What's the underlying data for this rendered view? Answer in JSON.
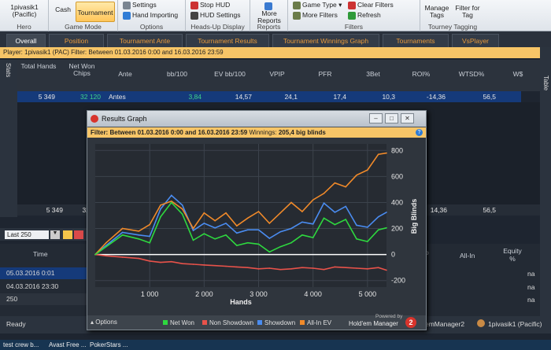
{
  "ribbon": {
    "hero": {
      "label": "1pivasik1 (Pacific)",
      "group": "Hero"
    },
    "game_mode": {
      "cash": "Cash",
      "tournament": "Tournament",
      "group": "Game Mode"
    },
    "options": {
      "settings": "Settings",
      "hand_importing": "Hand Importing",
      "group": "Options"
    },
    "hud": {
      "stop": "Stop HUD",
      "settings": "HUD Settings",
      "group": "Heads-Up Display"
    },
    "reports": {
      "more": "More Reports",
      "group": "Reports"
    },
    "filters": {
      "game_type": "Game Type",
      "more": "More Filters",
      "clear": "Clear Filters",
      "refresh": "Refresh",
      "group": "Filters"
    },
    "tagging": {
      "manage": "Manage Tags",
      "filter": "Filter for Tag",
      "group": "Tourney Tagging"
    }
  },
  "tabs": [
    "Overall",
    "Position",
    "Tournament Ante",
    "Tournament Results",
    "Tournament Winnings Graph",
    "Tournaments",
    "VsPlayer"
  ],
  "filter_line": "Player: 1pivasik1 (PAC)  Filter: Between 01.03.2016 0:00 and 16.03.2016 23:59",
  "side_left": "Stats",
  "side_right": "Table",
  "stats": {
    "columns": [
      "Total Hands",
      "Net Won Chips",
      "Ante",
      "bb/100",
      "EV bb/100",
      "VPIP",
      "PFR",
      "3Bet",
      "ROI%",
      "WTSD%",
      "W$"
    ],
    "row": [
      "5 349",
      "32 120",
      "Antes",
      "3,84",
      "14,57",
      "24,1",
      "17,4",
      "10,3",
      "-14,36",
      "56,5"
    ],
    "total": [
      "5 349",
      "32",
      "14,36",
      "56,5"
    ]
  },
  "session": {
    "range": "Last 250",
    "time_header": "Time",
    "rows": [
      "05.03.2016 0:01",
      "04.03.2016 23:30",
      "250"
    ]
  },
  "right_grid": {
    "headers": [
      "All-In",
      "Equity %"
    ],
    "values": [
      "na",
      "na",
      "na"
    ],
    "partial": "o"
  },
  "status": {
    "ready": "Ready",
    "manager": "emManager2",
    "player": "1pivasik1 (Pacific)"
  },
  "taskbar": [
    "test crew b...",
    "Avast Free ...",
    "PokerStars ..."
  ],
  "graph_window": {
    "title": "Results Graph",
    "filter_prefix": "Filter:",
    "filter_text": "Between 01.03.2016 0:00 and 16.03.2016 23:59",
    "winnings_label": "Winnings:",
    "winnings_value": "205,4 big blinds",
    "options": "Options",
    "powered_by": "Powered by",
    "brand": "Hold'em Manager"
  },
  "chart_data": {
    "type": "line",
    "title": "",
    "xlabel": "Hands",
    "ylabel": "Big Blinds",
    "xlim": [
      0,
      5349
    ],
    "ylim": [
      -250,
      850
    ],
    "x_ticks": [
      "1 000",
      "2 000",
      "3 000",
      "4 000",
      "5 000"
    ],
    "y_ticks": [
      "800",
      "600",
      "400",
      "200",
      "0",
      "-200"
    ],
    "series": [
      {
        "name": "Net Won",
        "color": "#2ed83f",
        "x": [
          0,
          200,
          500,
          800,
          1000,
          1200,
          1400,
          1600,
          1800,
          2000,
          2200,
          2400,
          2600,
          2800,
          3000,
          3200,
          3400,
          3600,
          3800,
          4000,
          4200,
          4400,
          4600,
          4800,
          5000,
          5200,
          5349
        ],
        "y": [
          0,
          60,
          150,
          120,
          90,
          290,
          400,
          310,
          110,
          160,
          120,
          150,
          70,
          90,
          80,
          20,
          60,
          90,
          150,
          130,
          280,
          230,
          270,
          120,
          100,
          190,
          205
        ]
      },
      {
        "name": "Non Showdown",
        "color": "#e8524a",
        "x": [
          0,
          200,
          500,
          800,
          1000,
          1200,
          1400,
          1600,
          1800,
          2000,
          2200,
          2400,
          2600,
          2800,
          3000,
          3200,
          3400,
          3600,
          3800,
          4000,
          4200,
          4400,
          4600,
          4800,
          5000,
          5200,
          5349
        ],
        "y": [
          0,
          -10,
          -20,
          -30,
          -50,
          -60,
          -55,
          -70,
          -75,
          -80,
          -85,
          -90,
          -95,
          -100,
          -110,
          -105,
          -115,
          -110,
          -100,
          -105,
          -115,
          -95,
          -100,
          -105,
          -110,
          -100,
          -120
        ]
      },
      {
        "name": "Showdown",
        "color": "#4a8cf0",
        "x": [
          0,
          200,
          500,
          800,
          1000,
          1200,
          1400,
          1600,
          1800,
          2000,
          2200,
          2400,
          2600,
          2800,
          3000,
          3200,
          3400,
          3600,
          3800,
          4000,
          4200,
          4400,
          4600,
          4800,
          5000,
          5200,
          5349
        ],
        "y": [
          0,
          70,
          170,
          150,
          140,
          350,
          455,
          380,
          185,
          240,
          205,
          240,
          165,
          190,
          190,
          125,
          175,
          200,
          250,
          235,
          395,
          325,
          370,
          225,
          210,
          290,
          325
        ]
      },
      {
        "name": "All-In EV",
        "color": "#f08a2a",
        "x": [
          0,
          200,
          500,
          800,
          1000,
          1200,
          1400,
          1600,
          1800,
          2000,
          2200,
          2400,
          2600,
          2800,
          3000,
          3200,
          3400,
          3600,
          3800,
          4000,
          4200,
          4400,
          4600,
          4800,
          5000,
          5200,
          5349
        ],
        "y": [
          0,
          90,
          200,
          180,
          230,
          380,
          410,
          350,
          200,
          320,
          260,
          320,
          220,
          280,
          330,
          240,
          320,
          400,
          330,
          420,
          470,
          550,
          520,
          610,
          650,
          770,
          780
        ]
      }
    ],
    "grid": true,
    "legend": "bottom"
  }
}
